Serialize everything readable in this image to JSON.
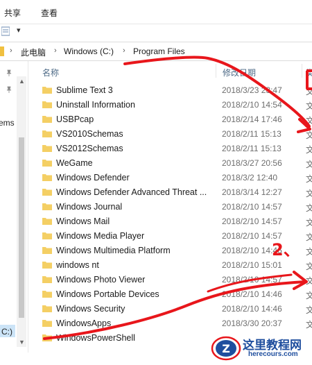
{
  "ribbon": {
    "tab_share": "共享",
    "tab_view": "查看"
  },
  "qat": {
    "dropdown": "▾"
  },
  "address": {
    "segments": [
      "此电脑",
      "Windows (C:)",
      "Program Files"
    ],
    "chevron": "›"
  },
  "nav": {
    "items_partial": "ems",
    "drive_partial": "C:)"
  },
  "columns": {
    "name": "名称",
    "modified": "修改日期",
    "type_partial": "类"
  },
  "files": [
    {
      "name": "Sublime Text 3",
      "modified": "2018/3/23 23:47",
      "type": "文"
    },
    {
      "name": "Uninstall Information",
      "modified": "2018/2/10 14:54",
      "type": "文"
    },
    {
      "name": "USBPcap",
      "modified": "2018/2/14 17:46",
      "type": "文"
    },
    {
      "name": "VS2010Schemas",
      "modified": "2018/2/11 15:13",
      "type": "文"
    },
    {
      "name": "VS2012Schemas",
      "modified": "2018/2/11 15:13",
      "type": "文"
    },
    {
      "name": "WeGame",
      "modified": "2018/3/27 20:56",
      "type": "文"
    },
    {
      "name": "Windows Defender",
      "modified": "2018/3/2 12:40",
      "type": "文"
    },
    {
      "name": "Windows Defender Advanced Threat ...",
      "modified": "2018/3/14 12:27",
      "type": "文"
    },
    {
      "name": "Windows Journal",
      "modified": "2018/2/10 14:57",
      "type": "文"
    },
    {
      "name": "Windows Mail",
      "modified": "2018/2/10 14:57",
      "type": "文"
    },
    {
      "name": "Windows Media Player",
      "modified": "2018/2/10 14:57",
      "type": "文"
    },
    {
      "name": "Windows Multimedia Platform",
      "modified": "2018/2/10 14:46",
      "type": "文"
    },
    {
      "name": "windows nt",
      "modified": "2018/2/10 15:01",
      "type": "文"
    },
    {
      "name": "Windows Photo Viewer",
      "modified": "2018/2/10 14:57",
      "type": "文"
    },
    {
      "name": "Windows Portable Devices",
      "modified": "2018/2/10 14:46",
      "type": "文"
    },
    {
      "name": "Windows Security",
      "modified": "2018/2/10 14:46",
      "type": "文"
    },
    {
      "name": "WindowsApps",
      "modified": "2018/3/30 20:37",
      "type": "文"
    },
    {
      "name": "WindowsPowerShell",
      "modified": "",
      "type": ""
    }
  ],
  "annotation": {
    "step_number": "2、"
  },
  "watermark": {
    "title": "这里教程网",
    "url": "herecours.com",
    "logo_letter": "Z"
  },
  "colors": {
    "folder": "#f4cf64",
    "annotation_red": "#e8161b",
    "header_text": "#4d6a86",
    "watermark_blue": "#1f4e9e"
  }
}
